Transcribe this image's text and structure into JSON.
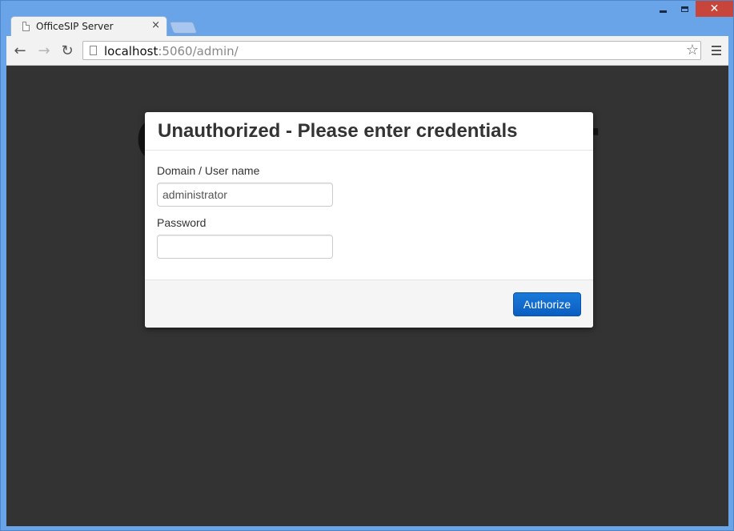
{
  "browser": {
    "tab": {
      "title": "OfficeSIP Server",
      "close_glyph": "×"
    },
    "address": {
      "host": "localhost",
      "rest": ":5060/admin/"
    },
    "icons": {
      "back": "←",
      "forward": "→",
      "reload": "↻",
      "star": "☆",
      "close_window": "✕"
    }
  },
  "page": {
    "background_title": "OfficeSIP Server",
    "background_color": "#333333"
  },
  "dialog": {
    "title": "Unauthorized - Please enter credentials",
    "username_label": "Domain / User name",
    "username_value": "administrator",
    "password_label": "Password",
    "password_value": "",
    "submit_label": "Authorize",
    "accent_color": "#0a63c9"
  }
}
